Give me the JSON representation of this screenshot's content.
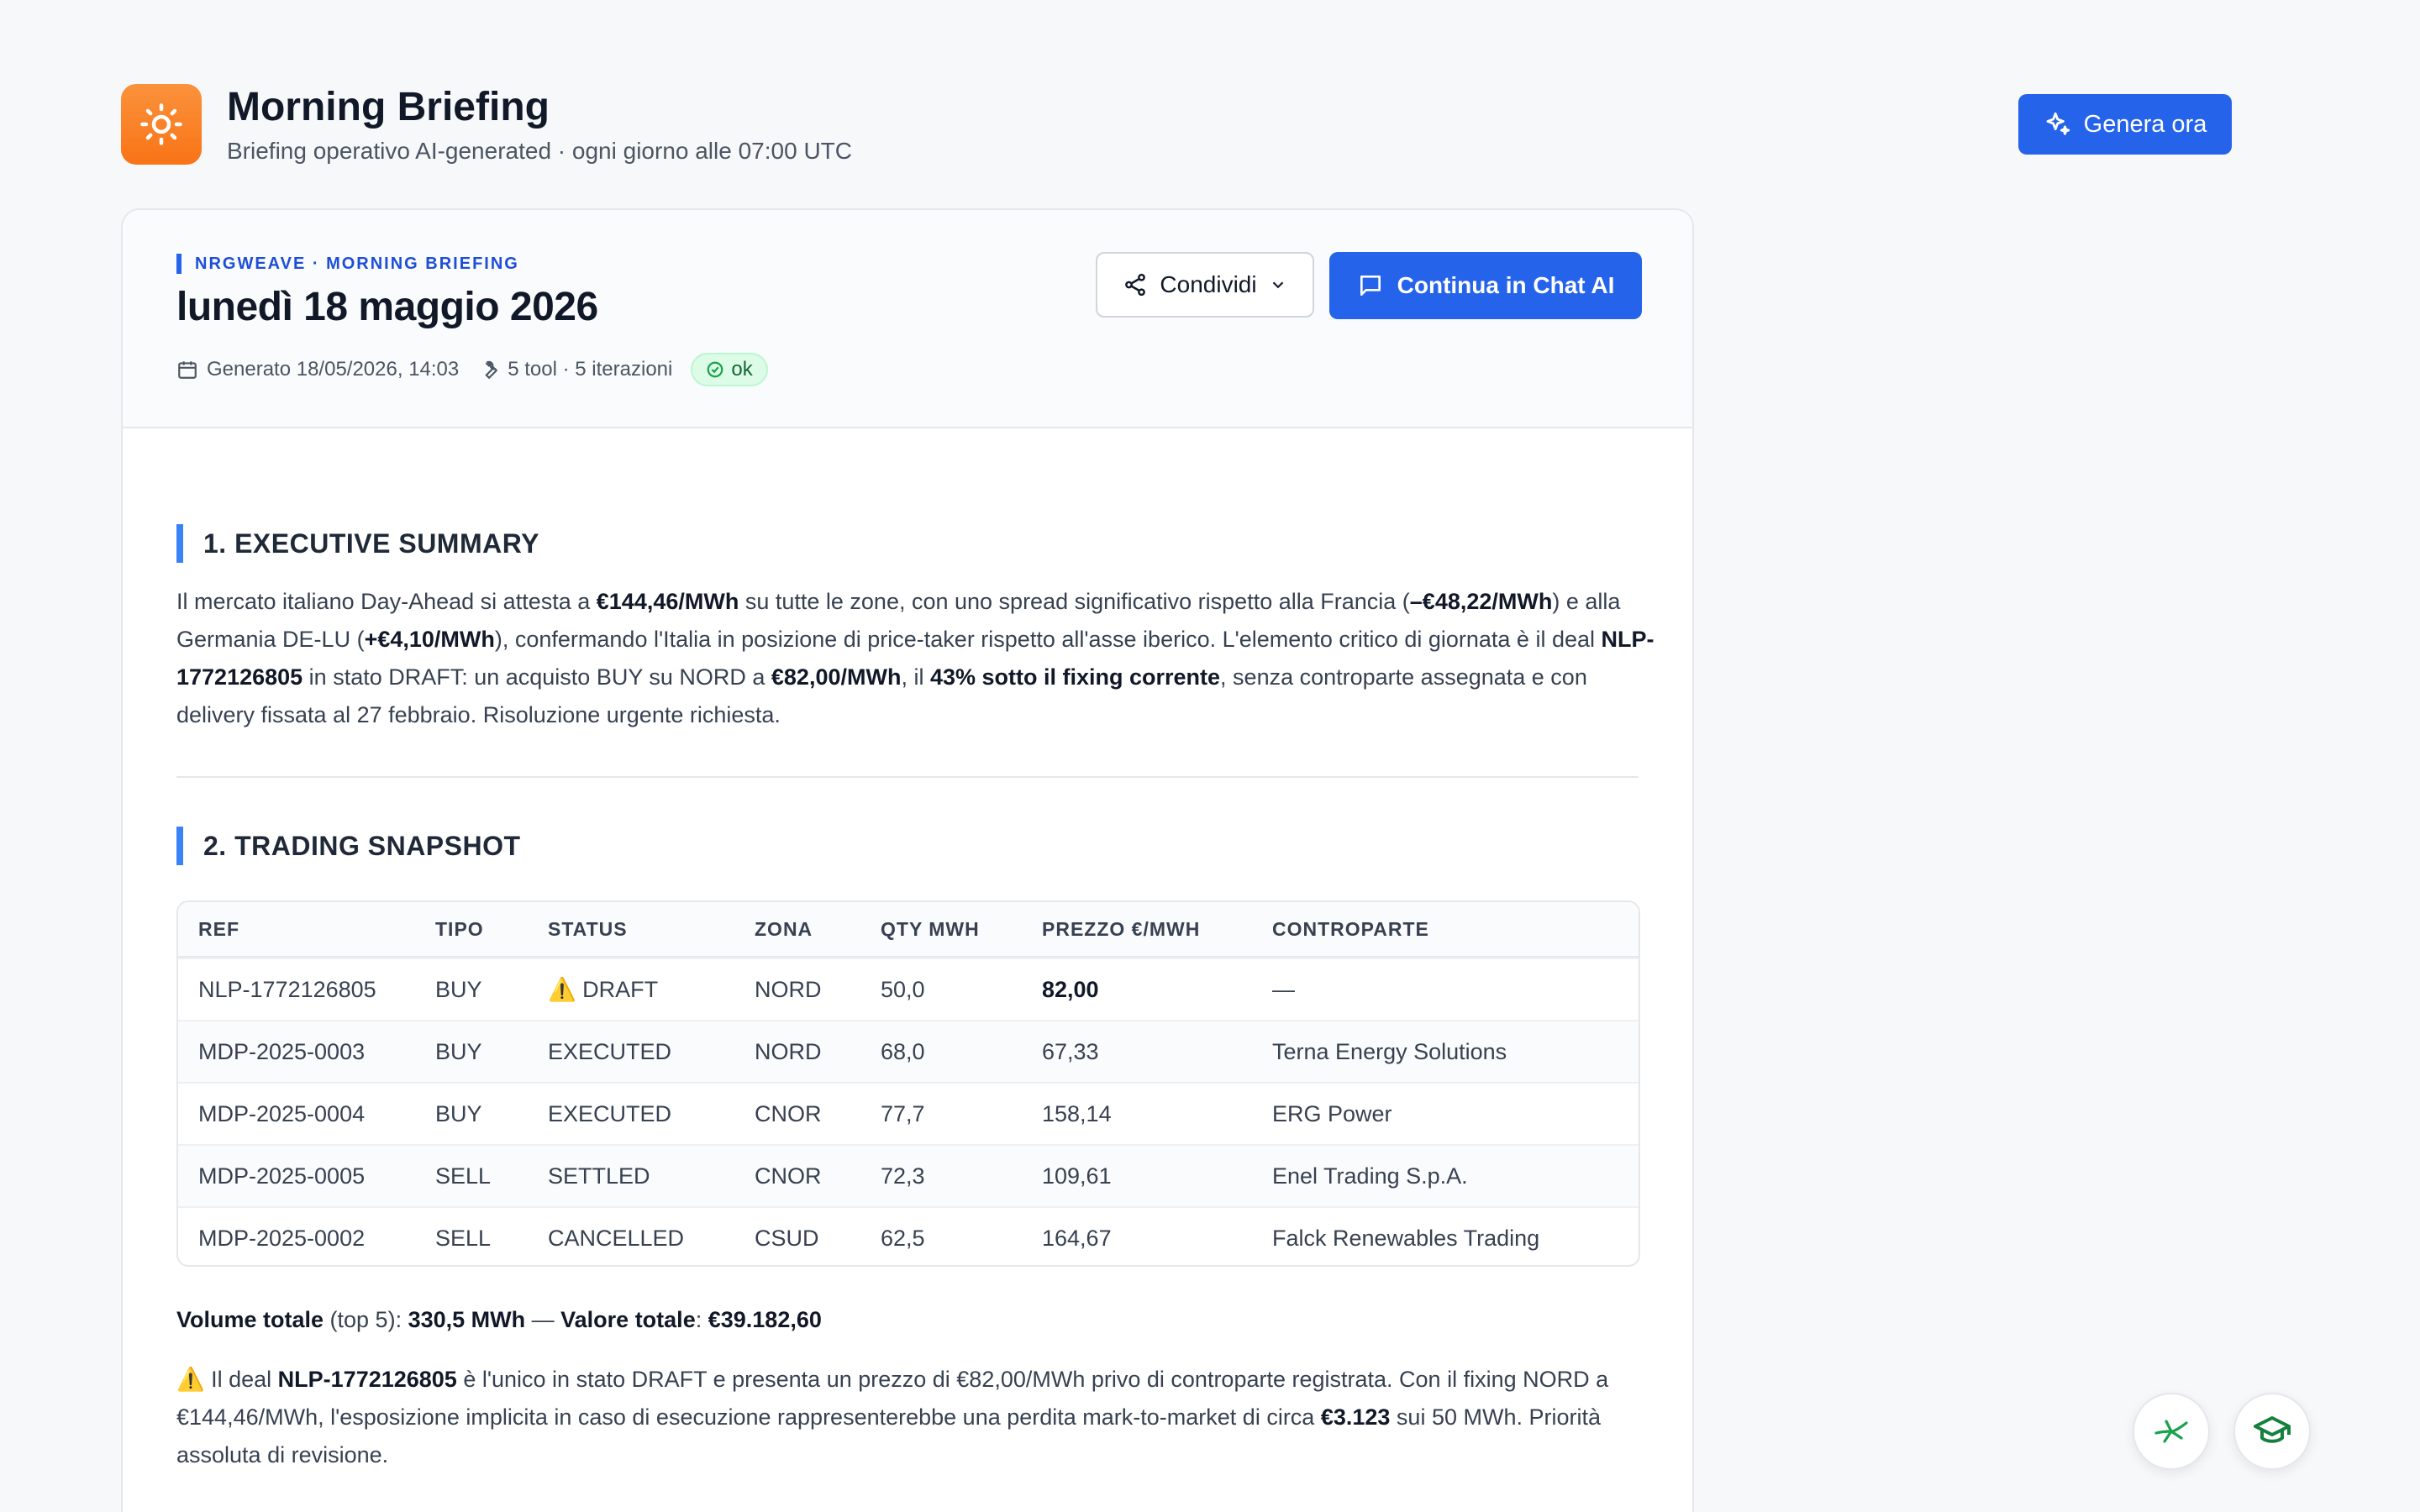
{
  "header": {
    "title": "Morning Briefing",
    "subtitle": "Briefing operativo AI-generated · ogni giorno alle 07:00 UTC",
    "generate_label": "Genera ora"
  },
  "card": {
    "eyebrow": "NRGWEAVE · MORNING BRIEFING",
    "date": "lunedì 18 maggio 2026",
    "generated": "Generato 18/05/2026, 14:03",
    "tools": "5 tool · 5 iterazioni",
    "status": "ok",
    "share_label": "Condividi",
    "chat_label": "Continua in Chat AI"
  },
  "summary": {
    "title": "1. EXECUTIVE SUMMARY",
    "t1": "Il mercato italiano Day-Ahead si attesta a ",
    "b1": "€144,46/MWh",
    "t2": " su tutte le zone, con uno spread significativo rispetto alla Francia (",
    "b2": "–€48,22/MWh",
    "t3": ") e alla Germania DE-LU (",
    "b3": "+€4,10/MWh",
    "t4": "), confermando l'Italia in posizione di price-taker rispetto all'asse iberico. L'elemento critico di giornata è il deal ",
    "b4": "NLP-1772126805",
    "t5": " in stato DRAFT: un acquisto BUY su NORD a ",
    "b5": "€82,00/MWh",
    "t6": ", il ",
    "b6": "43% sotto il fixing corrente",
    "t7": ", senza controparte assegnata e con delivery fissata al 27 febbraio. Risoluzione urgente richiesta."
  },
  "snapshot": {
    "title": "2. TRADING SNAPSHOT",
    "columns": [
      "REF",
      "TIPO",
      "STATUS",
      "ZONA",
      "QTY MWH",
      "PREZZO €/MWH",
      "CONTROPARTE"
    ],
    "rows": [
      [
        "NLP-1772126805",
        "BUY",
        "⚠️ DRAFT",
        "NORD",
        "50,0",
        "82,00",
        "—"
      ],
      [
        "MDP-2025-0003",
        "BUY",
        "EXECUTED",
        "NORD",
        "68,0",
        "67,33",
        "Terna Energy Solutions"
      ],
      [
        "MDP-2025-0004",
        "BUY",
        "EXECUTED",
        "CNOR",
        "77,7",
        "158,14",
        "ERG Power"
      ],
      [
        "MDP-2025-0005",
        "SELL",
        "SETTLED",
        "CNOR",
        "72,3",
        "109,61",
        "Enel Trading S.p.A."
      ],
      [
        "MDP-2025-0002",
        "SELL",
        "CANCELLED",
        "CSUD",
        "62,5",
        "164,67",
        "Falck Renewables Trading"
      ]
    ],
    "totals": {
      "vol_label": "Volume totale",
      "vol_mid": " (top 5): ",
      "vol_value": "330,5 MWh",
      "sep": " — ",
      "val_label": "Valore totale",
      "val_colon": ": ",
      "val_value": "€39.182,60"
    },
    "note": {
      "t1": "⚠️ Il deal ",
      "b1": "NLP-1772126805",
      "t2": " è l'unico in stato DRAFT e presenta un prezzo di €82,00/MWh privo di controparte registrata. Con il fixing NORD a €144,46/MWh, l'esposizione implicita in caso di esecuzione rappresenterebbe una perdita mark-to-market di circa ",
      "b2": "€3.123",
      "t3": " sui 50 MWh. Priorità assoluta di revisione."
    }
  },
  "icons": {
    "logo": "sun-icon",
    "generate": "sparkles-icon",
    "share": "share-icon",
    "chat": "chat-icon",
    "calendar": "calendar-icon",
    "tools": "wrench-icon",
    "ok": "check-circle-icon",
    "fab1": "snapshot-icon",
    "fab2": "graduation-cap-icon"
  },
  "colors": {
    "accent": "#2563eb",
    "logo": "#f97316",
    "ok": "#16a34a"
  }
}
